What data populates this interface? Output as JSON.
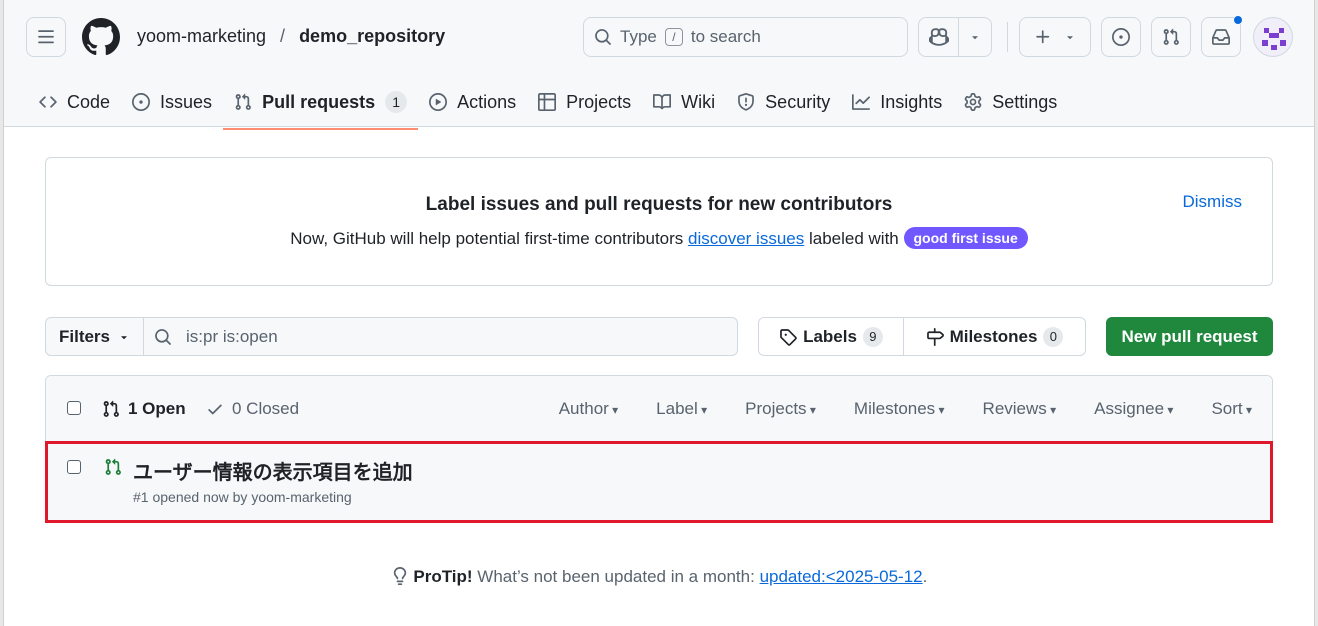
{
  "header": {
    "org": "yoom-marketing",
    "separator": "/",
    "repo": "demo_repository",
    "search": {
      "prefix": "Type",
      "key": "/",
      "suffix": "to search"
    }
  },
  "tabs": [
    {
      "label": "Code",
      "icon": "code-icon"
    },
    {
      "label": "Issues",
      "icon": "issue-opened-icon"
    },
    {
      "label": "Pull requests",
      "icon": "git-pull-request-icon",
      "count": "1",
      "active": true
    },
    {
      "label": "Actions",
      "icon": "play-icon"
    },
    {
      "label": "Projects",
      "icon": "table-icon"
    },
    {
      "label": "Wiki",
      "icon": "book-icon"
    },
    {
      "label": "Security",
      "icon": "shield-icon"
    },
    {
      "label": "Insights",
      "icon": "graph-icon"
    },
    {
      "label": "Settings",
      "icon": "gear-icon"
    }
  ],
  "banner": {
    "title": "Label issues and pull requests for new contributors",
    "text_before": "Now, GitHub will help potential first-time contributors",
    "link": "discover issues",
    "text_after": "labeled with",
    "badge": "good first issue",
    "badge_color": "#7057ff",
    "dismiss": "Dismiss"
  },
  "filters": {
    "button": "Filters",
    "query": "is:pr is:open",
    "labels_label": "Labels",
    "labels_count": "9",
    "milestones_label": "Milestones",
    "milestones_count": "0",
    "new_pr": "New pull request"
  },
  "list": {
    "open": "1 Open",
    "closed": "0 Closed",
    "menus": [
      "Author",
      "Label",
      "Projects",
      "Milestones",
      "Reviews",
      "Assignee",
      "Sort"
    ],
    "items": [
      {
        "title": "ユーザー情報の表示項目を追加",
        "meta": "#1 opened now by yoom-marketing",
        "status_color": "#1a7f37"
      }
    ]
  },
  "protip": {
    "label": "ProTip!",
    "text": "What’s not been updated in a month:",
    "link": "updated:<2025-05-12",
    "end": "."
  },
  "colors": {
    "accent": "#0969da",
    "green": "#1f883d",
    "tab_underline": "#fd8c73",
    "highlight": "#e0182b"
  }
}
